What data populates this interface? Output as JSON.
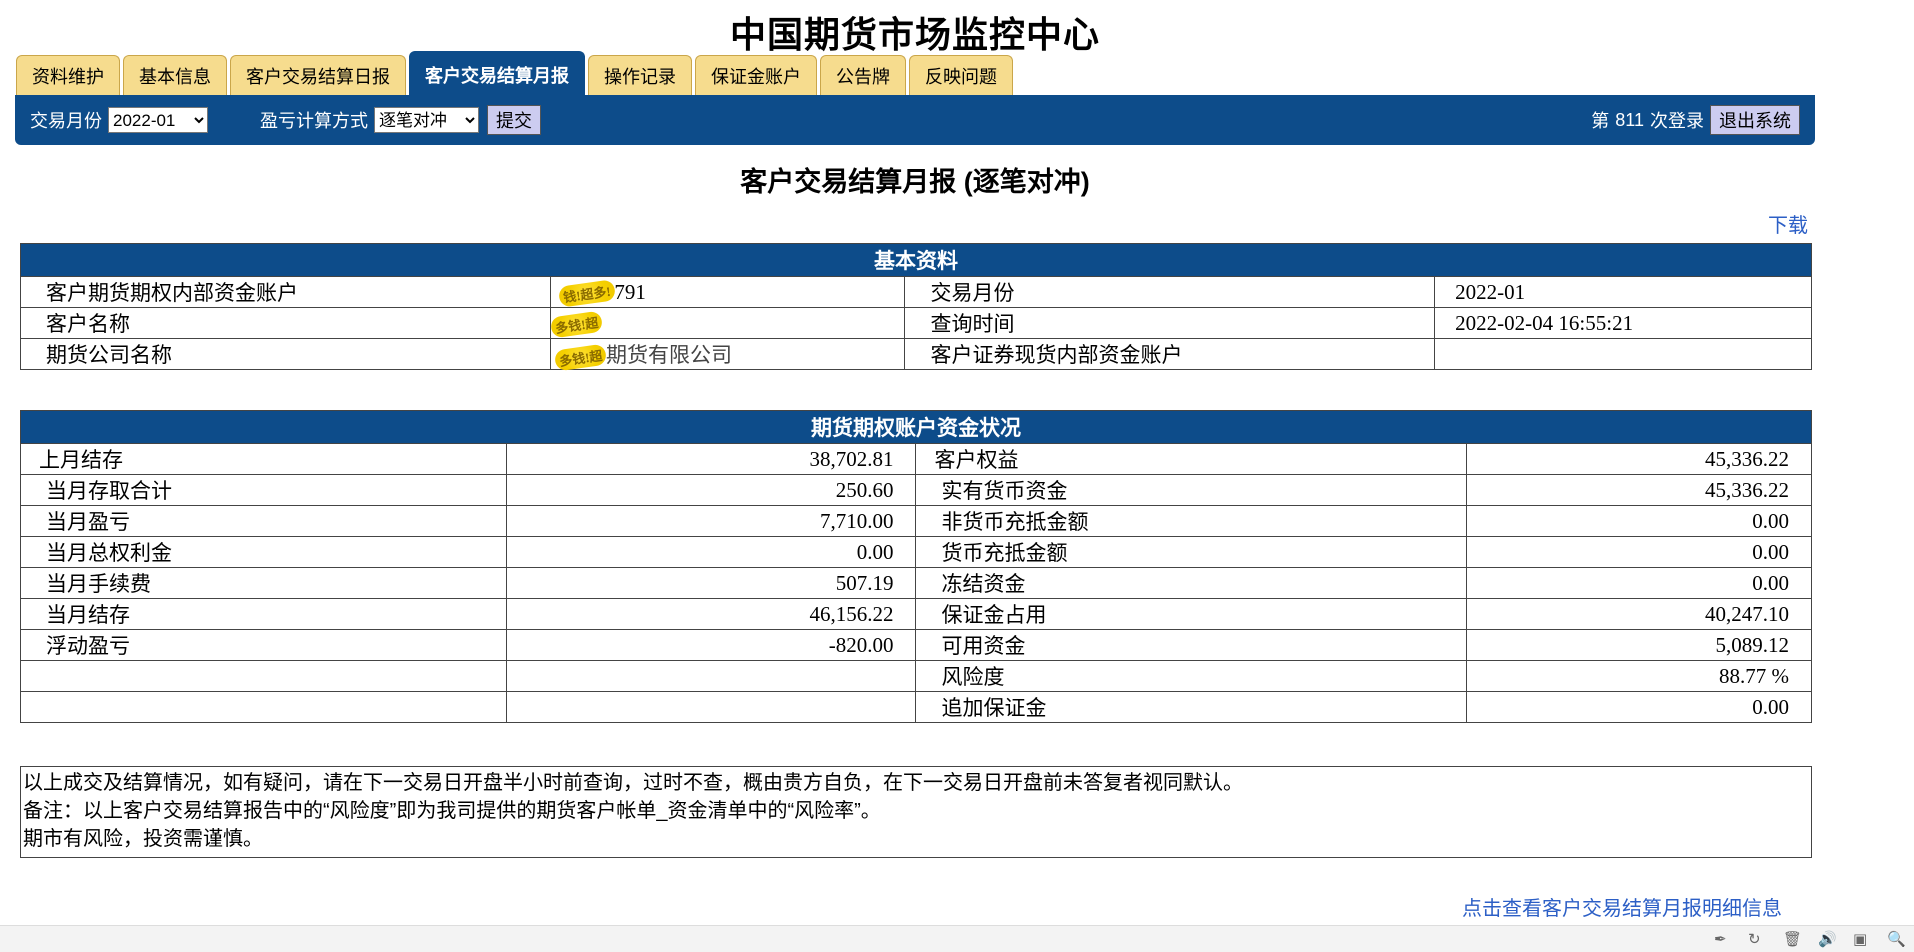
{
  "site_title": "中国期货市场监控中心",
  "tabs": [
    {
      "label": "资料维护",
      "active": false
    },
    {
      "label": "基本信息",
      "active": false
    },
    {
      "label": "客户交易结算日报",
      "active": false
    },
    {
      "label": "客户交易结算月报",
      "active": true
    },
    {
      "label": "操作记录",
      "active": false
    },
    {
      "label": "保证金账户",
      "active": false
    },
    {
      "label": "公告牌",
      "active": false
    },
    {
      "label": "反映问题",
      "active": false
    }
  ],
  "toolbar": {
    "month_label": "交易月份",
    "month_value": "2022-01",
    "method_label": "盈亏计算方式",
    "method_value": "逐笔对冲",
    "submit_label": "提交",
    "login_prefix": "第",
    "login_count": "811",
    "login_suffix": "次登录",
    "logout_label": "退出系统"
  },
  "report_title": "客户交易结算月报 (逐笔对冲)",
  "download_label": "下载",
  "basic_info": {
    "header": "基本资料",
    "rows": [
      {
        "label1": "客户期货期权内部资金账户",
        "value1": "791",
        "mask1": "钱!超多!",
        "label2": "交易月份",
        "value2": "2022-01"
      },
      {
        "label1": "客户名称",
        "value1": "",
        "mask1": "多钱!超",
        "label2": "查询时间",
        "value2": "2022-02-04 16:55:21"
      },
      {
        "label1": "期货公司名称",
        "value1": "期货有限公司",
        "mask1": "多钱!超",
        "label2": "客户证券现货内部资金账户",
        "value2": ""
      }
    ]
  },
  "funds": {
    "header": "期货期权账户资金状况",
    "rows": [
      {
        "label1": "上月结存",
        "value1": "38,702.81",
        "label2": "客户权益",
        "value2": "45,336.22"
      },
      {
        "label1": "当月存取合计",
        "value1": "250.60",
        "label2": "实有货币资金",
        "value2": "45,336.22"
      },
      {
        "label1": "当月盈亏",
        "value1": "7,710.00",
        "label2": "非货币充抵金额",
        "value2": "0.00"
      },
      {
        "label1": "当月总权利金",
        "value1": "0.00",
        "label2": "货币充抵金额",
        "value2": "0.00"
      },
      {
        "label1": "当月手续费",
        "value1": "507.19",
        "label2": "冻结资金",
        "value2": "0.00"
      },
      {
        "label1": "当月结存",
        "value1": "46,156.22",
        "label2": "保证金占用",
        "value2": "40,247.10"
      },
      {
        "label1": "浮动盈亏",
        "value1": "-820.00",
        "label2": "可用资金",
        "value2": "5,089.12"
      },
      {
        "label1": "",
        "value1": "",
        "label2": "风险度",
        "value2": "88.77 %"
      },
      {
        "label1": "",
        "value1": "",
        "label2": "追加保证金",
        "value2": "0.00"
      }
    ]
  },
  "notice": {
    "line1": "以上成交及结算情况，如有疑问，请在下一交易日开盘半小时前查询，过时不查，概由贵方自负，在下一交易日开盘前未答复者视同默认。",
    "line2": "备注：以上客户交易结算报告中的“风险度”即为我司提供的期货客户帐单_资金清单中的“风险率”。",
    "line3": "期市有风险，投资需谨慎。"
  },
  "detail_link": "点击查看客户交易结算月报明细信息",
  "statusbar_icons": [
    "pin-icon",
    "refresh-icon",
    "delete-icon",
    "volume-icon",
    "window-icon",
    "zoom-icon"
  ],
  "colors": {
    "primary": "#0d4c8a",
    "tab": "#f6dc8e",
    "link": "#2c5fc6"
  }
}
